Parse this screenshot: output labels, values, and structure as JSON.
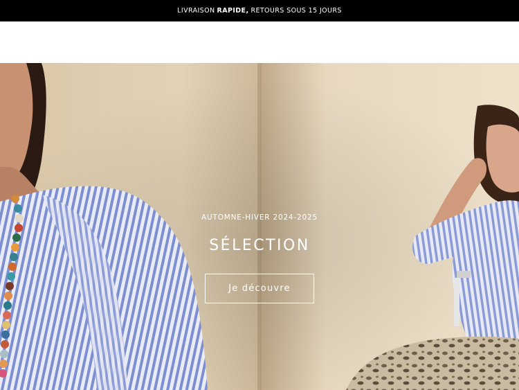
{
  "announcement": {
    "part1": "LIVRAISON",
    "bold": "RAPIDE,",
    "part2": "RETOURS SOUS 15 JOURS"
  },
  "hero": {
    "season": "AUTOMNE-HIVER 2024-2025",
    "title": "SÉLECTION",
    "cta_label": "Je découvre"
  },
  "colors": {
    "announcement_bg": "#000000",
    "hero_backdrop": "#e6d7bd",
    "shirt_stripe": "#7d8fd0"
  }
}
